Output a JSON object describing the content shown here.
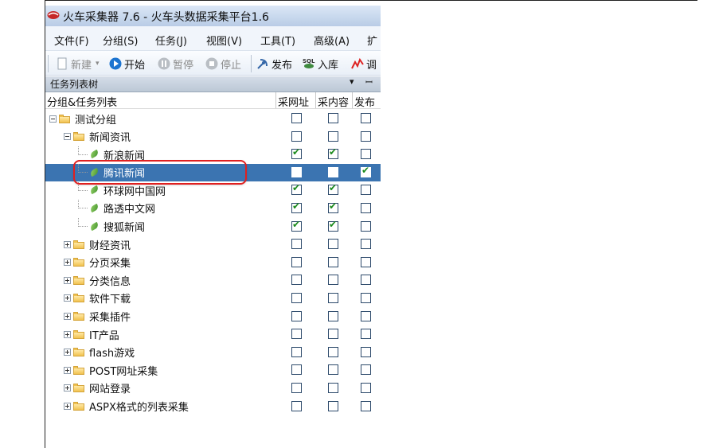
{
  "window": {
    "title": "火车采集器 7.6 - 火车头数据采集平台1.6"
  },
  "menu": [
    "文件(F)",
    "分组(S)",
    "任务(J)",
    "视图(V)",
    "工具(T)",
    "高级(A)",
    "扩"
  ],
  "toolbar": {
    "new_label": "新建",
    "start_label": "开始",
    "pause_label": "暂停",
    "stop_label": "停止",
    "publish_label": "发布",
    "import_label": "入库",
    "debug_label": "调"
  },
  "panel": {
    "title": "任务列表树",
    "dropdown": "▾",
    "pin": "ꟷ"
  },
  "columns": {
    "tree": "分组&任务列表",
    "collect_url": "采网址",
    "collect_content": "采内容",
    "publish": "发布"
  },
  "rows": [
    {
      "label": "测试分组",
      "type": "group",
      "level": 0,
      "expanded": true,
      "collect_url": false,
      "collect_content": false,
      "publish": false
    },
    {
      "label": "新闻资讯",
      "type": "group",
      "level": 1,
      "expanded": true,
      "collect_url": false,
      "collect_content": false,
      "publish": false
    },
    {
      "label": "新浪新闻",
      "type": "task",
      "level": 2,
      "collect_url": true,
      "collect_content": true,
      "publish": false
    },
    {
      "label": "腾讯新闻",
      "type": "task",
      "level": 2,
      "selected": true,
      "collect_url": false,
      "collect_content": false,
      "publish": true
    },
    {
      "label": "环球网中国网",
      "type": "task",
      "level": 2,
      "collect_url": true,
      "collect_content": true,
      "publish": false
    },
    {
      "label": "路透中文网",
      "type": "task",
      "level": 2,
      "collect_url": true,
      "collect_content": true,
      "publish": false
    },
    {
      "label": "搜狐新闻",
      "type": "task",
      "level": 2,
      "collect_url": true,
      "collect_content": true,
      "publish": false
    },
    {
      "label": "财经资讯",
      "type": "group",
      "level": 1,
      "expanded": false,
      "collect_url": false,
      "collect_content": false,
      "publish": false
    },
    {
      "label": "分页采集",
      "type": "group",
      "level": 1,
      "expanded": false,
      "collect_url": false,
      "collect_content": false,
      "publish": false
    },
    {
      "label": "分类信息",
      "type": "group",
      "level": 1,
      "expanded": false,
      "collect_url": false,
      "collect_content": false,
      "publish": false
    },
    {
      "label": "软件下载",
      "type": "group",
      "level": 1,
      "expanded": false,
      "collect_url": false,
      "collect_content": false,
      "publish": false
    },
    {
      "label": "采集插件",
      "type": "group",
      "level": 1,
      "expanded": false,
      "collect_url": false,
      "collect_content": false,
      "publish": false
    },
    {
      "label": "IT产品",
      "type": "group",
      "level": 1,
      "expanded": false,
      "collect_url": false,
      "collect_content": false,
      "publish": false
    },
    {
      "label": "flash游戏",
      "type": "group",
      "level": 1,
      "expanded": false,
      "collect_url": false,
      "collect_content": false,
      "publish": false
    },
    {
      "label": "POST网址采集",
      "type": "group",
      "level": 1,
      "expanded": false,
      "collect_url": false,
      "collect_content": false,
      "publish": false
    },
    {
      "label": "网站登录",
      "type": "group",
      "level": 1,
      "expanded": false,
      "collect_url": false,
      "collect_content": false,
      "publish": false
    },
    {
      "label": "ASPX格式的列表采集",
      "type": "group",
      "level": 1,
      "expanded": false,
      "collect_url": false,
      "collect_content": false,
      "publish": false
    }
  ],
  "colors": {
    "selected_row": "#3b74b1",
    "highlight_annotation": "#e02020",
    "check": "#1b8a1b"
  }
}
